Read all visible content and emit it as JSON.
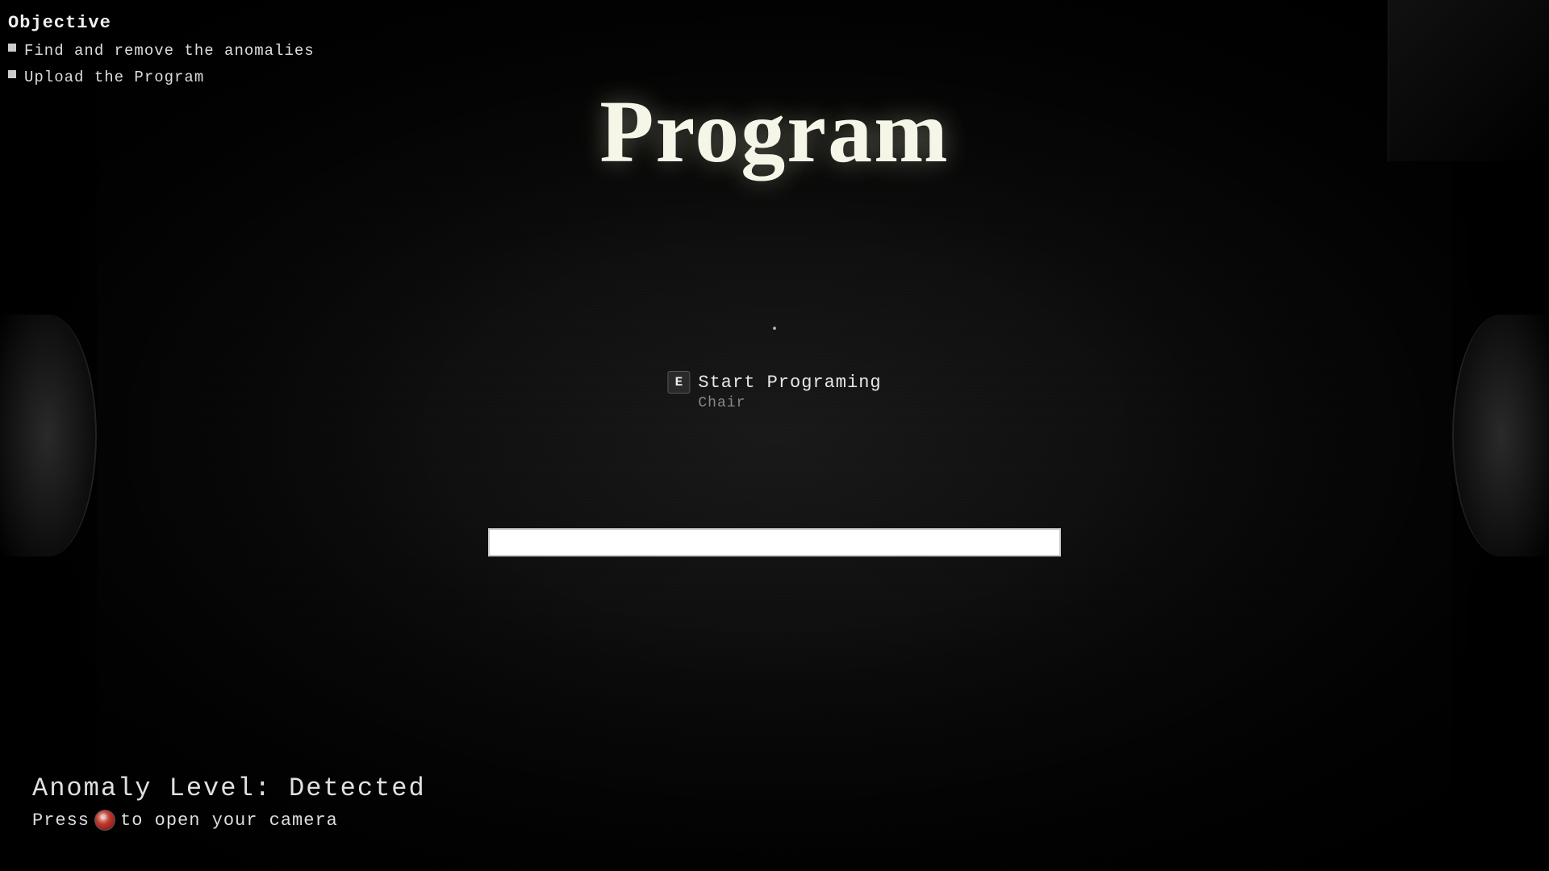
{
  "background": {
    "color": "#0d0d0d"
  },
  "objective": {
    "title": "Objective",
    "items": [
      {
        "text": "Find and remove the anomalies"
      },
      {
        "text": "Upload the Program"
      }
    ]
  },
  "main_title": "Program",
  "center_dot": true,
  "interaction": {
    "key": "E",
    "action": "Start Programing",
    "sub": "Chair"
  },
  "progress_bar": {
    "fill_percent": 100
  },
  "hud": {
    "anomaly_level": "Anomaly Level: Detected",
    "camera_prompt_prefix": "Press ",
    "camera_prompt_suffix": "to open your camera"
  }
}
